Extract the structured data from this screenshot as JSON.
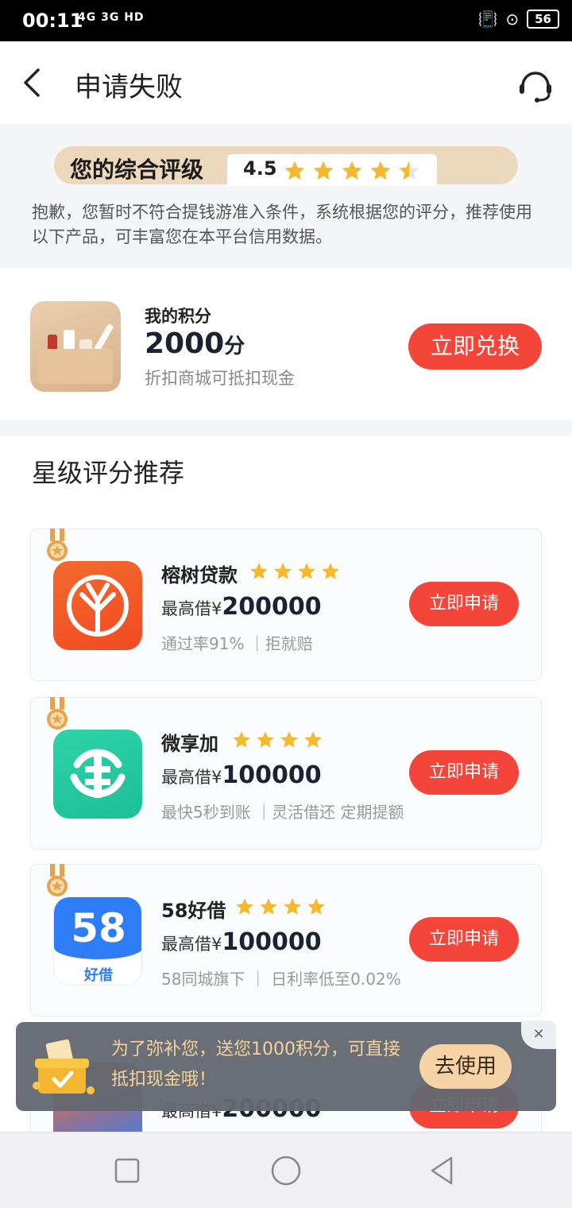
{
  "status_bar": {
    "time": "00:11",
    "network": "4G 3G HD",
    "battery": "56"
  },
  "header": {
    "title": "申请失败",
    "back_icon": "chevron-left-icon",
    "service_icon": "customer-service-headset-icon"
  },
  "rating": {
    "label": "您的综合评级",
    "score": "4.5",
    "stars": 4.5,
    "description": "抱歉，您暂时不符合提钱游准入条件，系统根据您的评分，推荐使用以下产品，可丰富您在本平台信用数据。"
  },
  "points": {
    "label": "我的积分",
    "value": "2000",
    "unit": "分",
    "subtitle": "折扣商城可抵扣现金",
    "button": "立即兑换"
  },
  "recommend": {
    "title": "星级评分推荐",
    "products": [
      {
        "name": "榕树贷款",
        "stars": 4,
        "limit_prefix": "最高借¥",
        "limit_amount": "200000",
        "tags": "通过率91% ｜拒就赔",
        "button": "立即申请",
        "logo_color": "#f45a2c"
      },
      {
        "name": "微享加",
        "stars": 4,
        "limit_prefix": "最高借¥",
        "limit_amount": "100000",
        "tags": "最快5秒到账 ｜灵活借还 定期提额",
        "button": "立即申请",
        "logo_color": "#21c8a0"
      },
      {
        "name": "58好借",
        "stars": 4,
        "limit_prefix": "最高借¥",
        "limit_amount": "100000",
        "tags": "58同城旗下 ｜ 日利率低至0.02%",
        "button": "立即申请",
        "logo_color": "#2f7df6",
        "logo_text": "58",
        "logo_subtext": "好借"
      },
      {
        "limit_prefix": "最高借¥",
        "limit_amount": "200000",
        "button": "立即申请"
      }
    ]
  },
  "toast": {
    "text": "为了弥补您，送您1000积分，可直接抵扣现金哦！",
    "button": "去使用",
    "close": "×"
  },
  "colors": {
    "primary_red": "#f4453a",
    "star_gold": "#f5b92e",
    "rating_bg": "#ecd8bc"
  }
}
